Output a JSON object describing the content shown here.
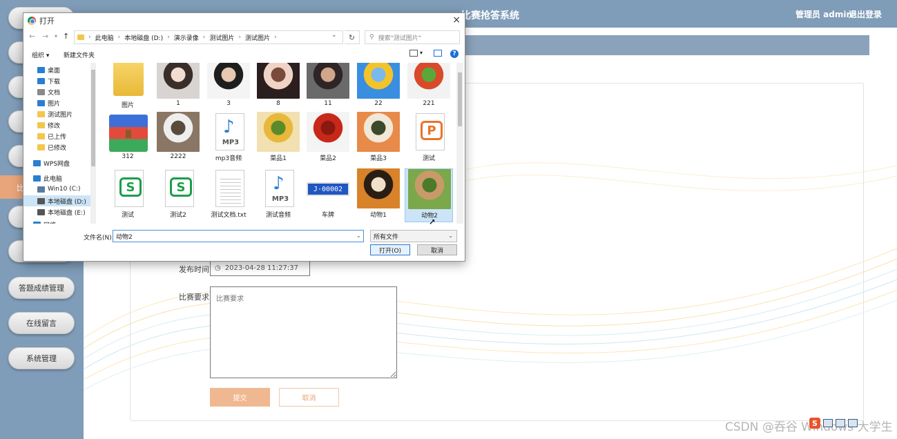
{
  "app": {
    "title": "比赛抢答系统",
    "admin": "管理员 admin",
    "logout": "退出登录"
  },
  "sidebar": {
    "items": [
      {
        "label": ""
      },
      {
        "label": ""
      },
      {
        "label": ""
      },
      {
        "label": ""
      },
      {
        "label": ""
      },
      {
        "label": "比"
      },
      {
        "label": ""
      },
      {
        "label": ""
      },
      {
        "label": "答题成绩管理"
      },
      {
        "label": "在线留言"
      },
      {
        "label": "系统管理"
      }
    ]
  },
  "form": {
    "publish_time_label": "发布时间",
    "publish_time_value": "2023-04-28 11:27:37",
    "requirement_label": "比赛要求",
    "requirement_placeholder": "比赛要求",
    "submit": "提交",
    "cancel": "取消"
  },
  "watermark": "CSDN @吞谷 Windows 大学生",
  "dialog": {
    "title": "打开",
    "close": "×",
    "breadcrumbs": [
      "此电脑",
      "本地磁盘 (D:)",
      "演示录像",
      "测试图片",
      "测试图片"
    ],
    "search_placeholder": "搜索\"测试图片\"",
    "organize": "组织 ▾",
    "new_folder": "新建文件夹",
    "nav_items": [
      {
        "label": "桌面",
        "color": "#2a7fd0",
        "pinned": true
      },
      {
        "label": "下载",
        "color": "#2a7fd0",
        "pinned": true
      },
      {
        "label": "文档",
        "color": "#8a8a8a",
        "pinned": true
      },
      {
        "label": "图片",
        "color": "#2a7fd0",
        "pinned": true
      },
      {
        "label": "测试图片",
        "color": "#f3c64c",
        "pinned": false
      },
      {
        "label": "修改",
        "color": "#f3c64c",
        "pinned": false
      },
      {
        "label": "已上传",
        "color": "#f3c64c",
        "pinned": false
      },
      {
        "label": "已修改",
        "color": "#f3c64c",
        "pinned": false
      },
      {
        "label": "WPS网盘",
        "color": "#2a7fd0",
        "pinned": false
      },
      {
        "label": "此电脑",
        "color": "#2a7fd0",
        "pinned": false
      },
      {
        "label": "Win10 (C:)",
        "color": "#5a7a9a",
        "pinned": false
      },
      {
        "label": "本地磁盘 (D:)",
        "color": "#555555",
        "pinned": false
      },
      {
        "label": "本地磁盘 (E:)",
        "color": "#555555",
        "pinned": false
      },
      {
        "label": "网络",
        "color": "#2a7fd0",
        "pinned": false
      }
    ],
    "files": [
      {
        "name": "图片",
        "kind": "folder"
      },
      {
        "name": "1",
        "kind": "photo",
        "colors": [
          "#d8d4d2",
          "#3a2e2a",
          "#f2ddd0"
        ]
      },
      {
        "name": "3",
        "kind": "photo",
        "colors": [
          "#f4f4f4",
          "#1e1e1e",
          "#e8c8b0"
        ]
      },
      {
        "name": "8",
        "kind": "photo",
        "colors": [
          "#2a1e1e",
          "#efd4c6",
          "#7a4a3a"
        ]
      },
      {
        "name": "11",
        "kind": "photo",
        "colors": [
          "#6a6a6a",
          "#2e2626",
          "#d2a68a"
        ]
      },
      {
        "name": "22",
        "kind": "photo",
        "colors": [
          "#3a8ee0",
          "#f3c42a",
          "#7ab8ee"
        ]
      },
      {
        "name": "221",
        "kind": "photo",
        "colors": [
          "#f2f2f2",
          "#d84a2a",
          "#5aa83a"
        ]
      },
      {
        "name": "312",
        "kind": "archive"
      },
      {
        "name": "2222",
        "kind": "photo",
        "colors": [
          "#8a7664",
          "#eeeeee",
          "#5a4a3a"
        ]
      },
      {
        "name": "mp3音频",
        "kind": "mp3"
      },
      {
        "name": "菜品1",
        "kind": "photo",
        "colors": [
          "#f2e0b0",
          "#e8b83a",
          "#5a8a2a"
        ]
      },
      {
        "name": "菜品2",
        "kind": "photo",
        "colors": [
          "#f4f4f4",
          "#c8281a",
          "#8a1a10"
        ]
      },
      {
        "name": "菜品3",
        "kind": "photo",
        "colors": [
          "#e88a4a",
          "#f2e8d8",
          "#3a4a2a"
        ]
      },
      {
        "name": "测试",
        "kind": "wps-p"
      },
      {
        "name": "测试",
        "kind": "wps-s"
      },
      {
        "name": "测试2",
        "kind": "wps-s"
      },
      {
        "name": "测试文档.txt",
        "kind": "txt"
      },
      {
        "name": "测试音频",
        "kind": "mp3"
      },
      {
        "name": "车牌",
        "kind": "plate",
        "plate_text": "J·00002"
      },
      {
        "name": "动物1",
        "kind": "photo",
        "colors": [
          "#d8822a",
          "#2a1e14",
          "#f0e0c8"
        ]
      },
      {
        "name": "动物2",
        "kind": "photo",
        "colors": [
          "#7aa84a",
          "#c89a6a",
          "#4a7a2a"
        ],
        "selected": true
      }
    ],
    "filename_label": "文件名(N):",
    "filename_value": "动物2",
    "filetype_value": "所有文件",
    "open": "打开(O)",
    "cancel": "取消"
  }
}
